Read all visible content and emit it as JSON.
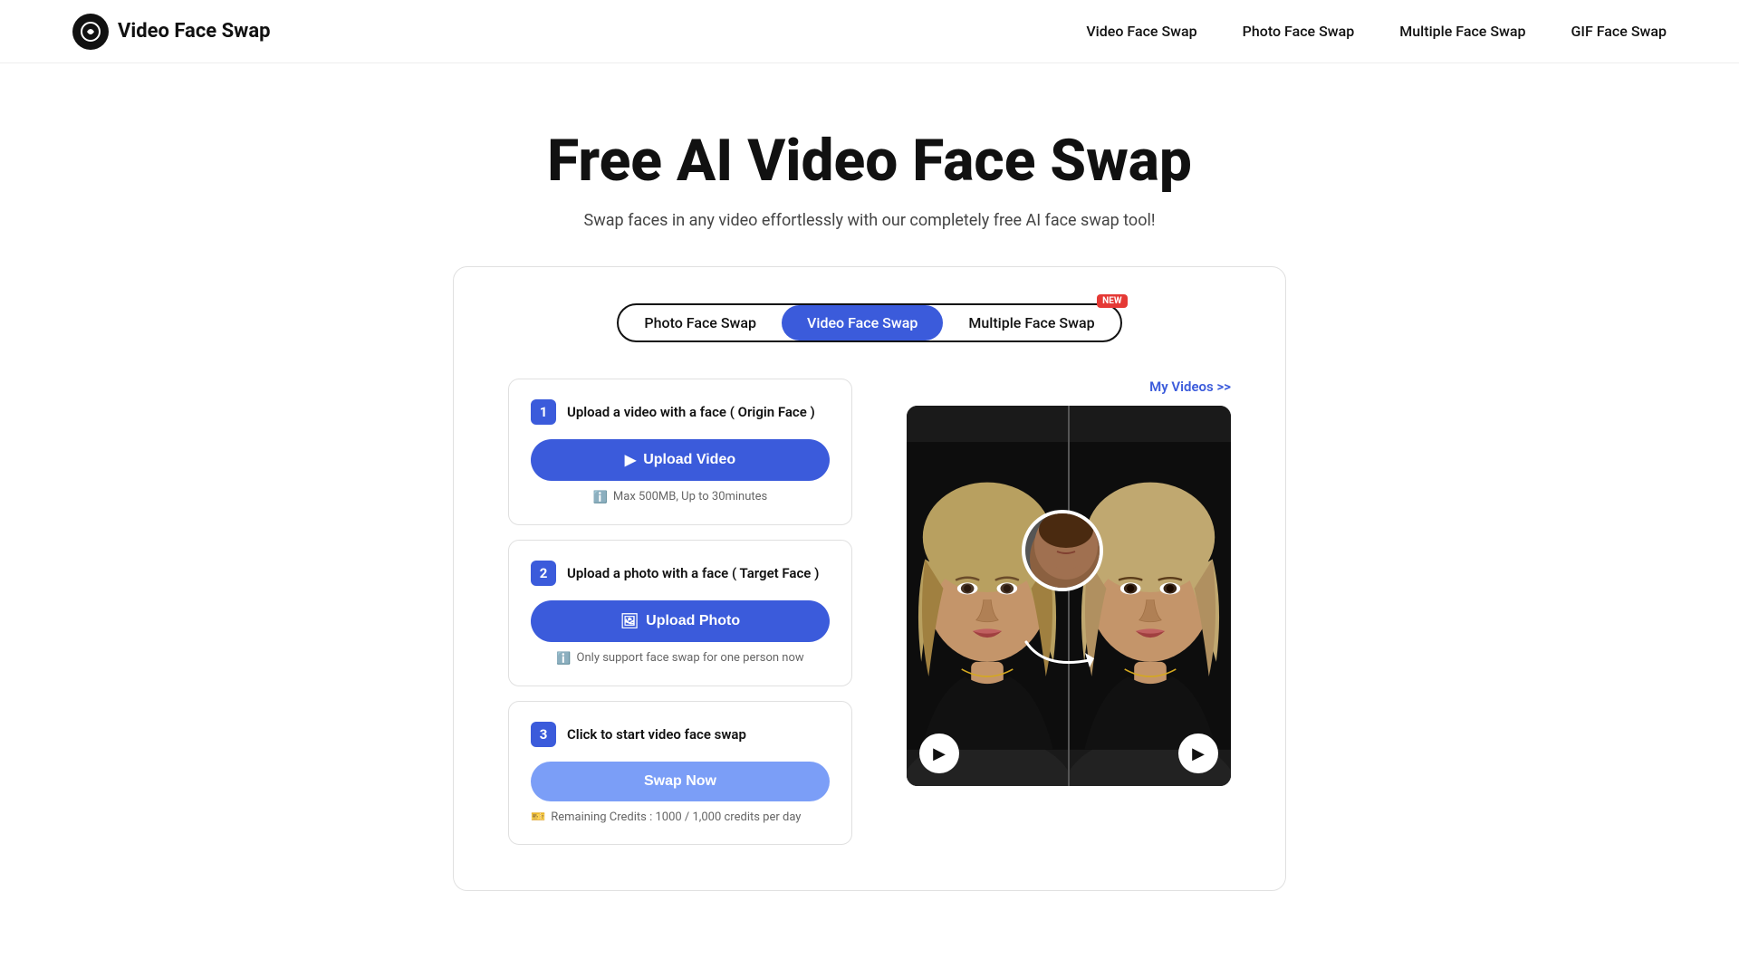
{
  "app": {
    "logo_icon": "◎",
    "logo_text": "Video Face Swap"
  },
  "nav": {
    "links": [
      {
        "label": "Video Face Swap",
        "id": "nav-video-face-swap"
      },
      {
        "label": "Photo Face Swap",
        "id": "nav-photo-face-swap"
      },
      {
        "label": "Multiple Face Swap",
        "id": "nav-multiple-face-swap"
      },
      {
        "label": "GIF Face Swap",
        "id": "nav-gif-face-swap"
      }
    ]
  },
  "hero": {
    "title": "Free AI Video Face Swap",
    "subtitle": "Swap faces in any video effortlessly with our completely free AI face swap tool!"
  },
  "tabs": [
    {
      "label": "Photo Face Swap",
      "active": false,
      "new": false
    },
    {
      "label": "Video Face Swap",
      "active": true,
      "new": false
    },
    {
      "label": "Multiple Face Swap",
      "active": false,
      "new": true
    }
  ],
  "new_badge": "NEW",
  "steps": [
    {
      "num": "1",
      "title": "Upload a video with a face ( Origin Face )",
      "button": "Upload Video",
      "hint": "Max 500MB, Up to 30minutes",
      "hint_icon": "ℹ"
    },
    {
      "num": "2",
      "title": "Upload a photo with a face ( Target Face )",
      "button": "Upload Photo",
      "hint": "Only support face swap for one person now",
      "hint_icon": "ℹ"
    },
    {
      "num": "3",
      "title": "Click to start video face swap",
      "button": "Swap Now",
      "hint": "Remaining Credits : 1000 / 1,000 credits per day",
      "hint_icon": "🎫"
    }
  ],
  "my_videos_link": "My Videos >>",
  "colors": {
    "primary": "#3b5bdb",
    "swap_btn": "#7b9ef7"
  }
}
